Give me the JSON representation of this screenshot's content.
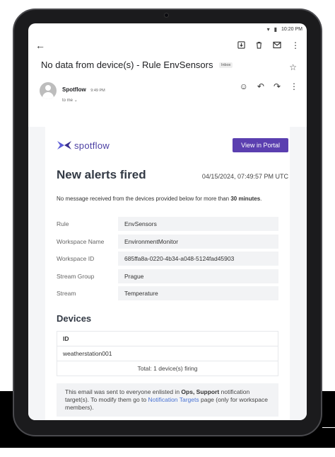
{
  "status_bar": {
    "time": "10:20 PM"
  },
  "email": {
    "subject": "No data from device(s) - Rule EnvSensors",
    "label": "Inbox",
    "sender": {
      "name": "Spotflow",
      "time": "9:49 PM",
      "to": "to me"
    }
  },
  "content": {
    "logo_text": "spotflow",
    "portal_button": "View in Portal",
    "title": "New alerts fired",
    "date": "04/15/2024, 07:49:57 PM UTC",
    "message_pre": "No message received from the devices provided below for more than ",
    "message_bold": "30 minutes",
    "message_post": ".",
    "details": [
      {
        "key": "Rule",
        "value": "EnvSensors"
      },
      {
        "key": "Workspace Name",
        "value": "EnvironmentMonitor"
      },
      {
        "key": "Workspace ID",
        "value": "685ffa8a-0220-4b34-a048-5124fad45903"
      },
      {
        "key": "Stream Group",
        "value": "Prague"
      },
      {
        "key": "Stream",
        "value": "Temperature"
      }
    ],
    "devices_heading": "Devices",
    "devices_column": "ID",
    "devices": [
      "weatherstation001"
    ],
    "devices_total": "Total: 1 device(s) firing",
    "footer": {
      "t1": "This email was sent to everyone enlisted in ",
      "groups": "Ops, Support",
      "t2": " notification target(s). To modify them go to ",
      "link": "Notification Targets",
      "t3": " page (only for workspace members)."
    }
  },
  "icons": {
    "back": "arrow-left",
    "archive": "archive",
    "delete": "trash",
    "mark_unread": "mail",
    "more": "more-vertical",
    "star": "star",
    "emoji": "emoji",
    "reply": "reply",
    "forward": "forward"
  }
}
